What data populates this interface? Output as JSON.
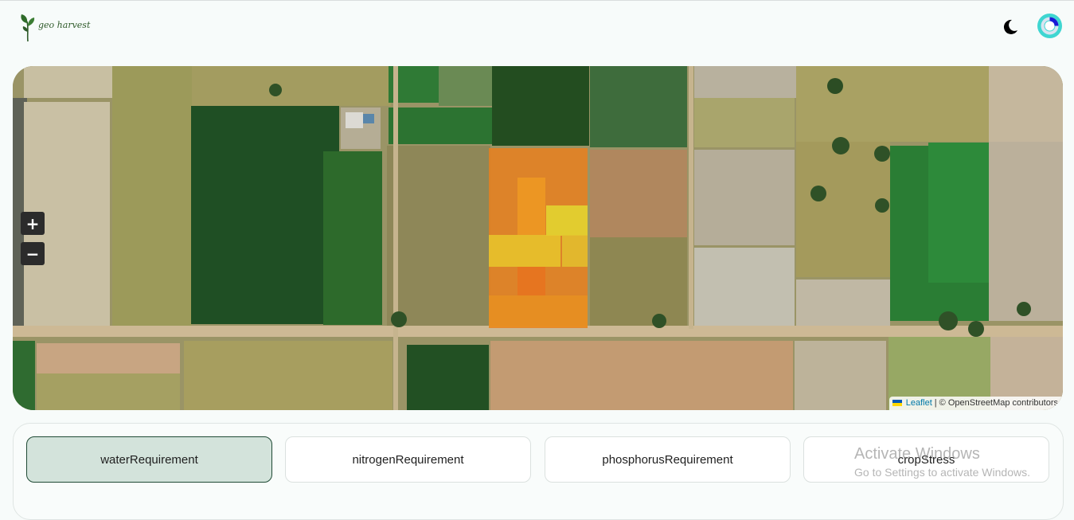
{
  "app": {
    "logo_text": "geo harvest"
  },
  "header": {
    "theme_toggle_icon": "moon-icon",
    "avatar_icon": "profile-loader-icon",
    "accent": "#3fd6d1"
  },
  "map": {
    "zoom_in_label": "+",
    "zoom_out_label": "−",
    "attribution": {
      "leaflet": "Leaflet",
      "separator": "|",
      "osm": "© OpenStreetMap contributors"
    },
    "overlay_colors": [
      "#e9801f",
      "#ee9a22",
      "#e7c72c",
      "#e3d930"
    ]
  },
  "tabs": [
    {
      "label": "waterRequirement",
      "active": true
    },
    {
      "label": "nitrogenRequirement",
      "active": false
    },
    {
      "label": "phosphorusRequirement",
      "active": false
    },
    {
      "label": "cropStress",
      "active": false
    }
  ],
  "watermark": {
    "title": "Activate Windows",
    "subtitle": "Go to Settings to activate Windows."
  }
}
